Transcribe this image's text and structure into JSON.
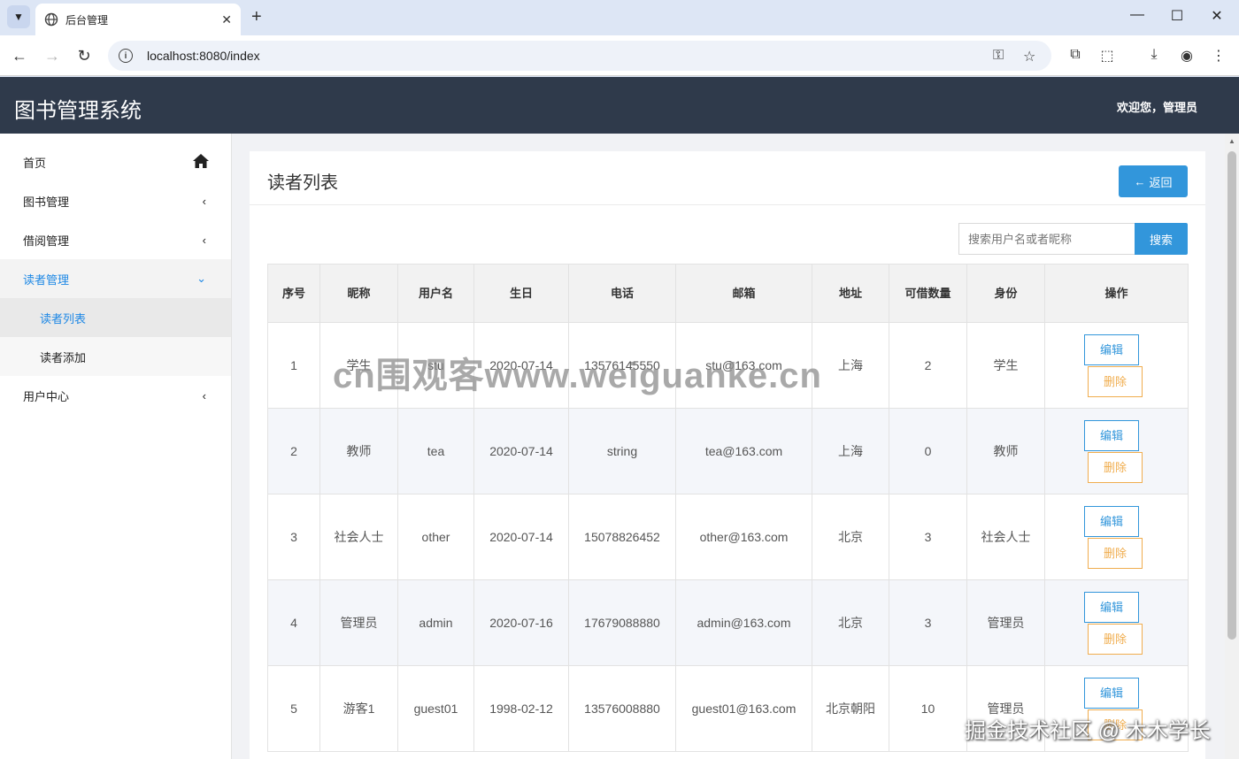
{
  "browser": {
    "tab_title": "后台管理",
    "url": "localhost:8080/index"
  },
  "app": {
    "title": "图书管理系统",
    "welcome": "欢迎您，管理员"
  },
  "sidebar": {
    "items": [
      {
        "label": "首页",
        "icon": "home-icon"
      },
      {
        "label": "图书管理",
        "icon": "chevron-left-icon"
      },
      {
        "label": "借阅管理",
        "icon": "chevron-left-icon"
      },
      {
        "label": "读者管理",
        "icon": "chevron-down-icon"
      },
      {
        "label": "用户中心",
        "icon": "chevron-left-icon"
      }
    ],
    "sub_items": [
      {
        "label": "读者列表"
      },
      {
        "label": "读者添加"
      }
    ]
  },
  "page": {
    "title": "读者列表",
    "back_label": "返回",
    "search_placeholder": "搜索用户名或者昵称",
    "search_label": "搜索"
  },
  "table": {
    "headers": [
      "序号",
      "昵称",
      "用户名",
      "生日",
      "电话",
      "邮箱",
      "地址",
      "可借数量",
      "身份",
      "操作"
    ],
    "edit_label": "编辑",
    "delete_label": "删除",
    "rows": [
      [
        "1",
        "学生",
        "stu",
        "2020-07-14",
        "13576145550",
        "stu@163.com",
        "上海",
        "2",
        "学生"
      ],
      [
        "2",
        "教师",
        "tea",
        "2020-07-14",
        "string",
        "tea@163.com",
        "上海",
        "0",
        "教师"
      ],
      [
        "3",
        "社会人士",
        "other",
        "2020-07-14",
        "15078826452",
        "other@163.com",
        "北京",
        "3",
        "社会人士"
      ],
      [
        "4",
        "管理员",
        "admin",
        "2020-07-16",
        "17679088880",
        "admin@163.com",
        "北京",
        "3",
        "管理员"
      ],
      [
        "5",
        "游客1",
        "guest01",
        "1998-02-12",
        "13576008880",
        "guest01@163.com",
        "北京朝阳",
        "10",
        "管理员"
      ]
    ]
  },
  "watermarks": {
    "center": "cn围观客www.weiguanke.cn",
    "corner": "掘金技术社区 @ 木木学长"
  },
  "colors": {
    "header_bg": "#2f3a4b",
    "accent": "#3296db",
    "danger_outline": "#f0ad4e",
    "active_link": "#1e88e5"
  }
}
